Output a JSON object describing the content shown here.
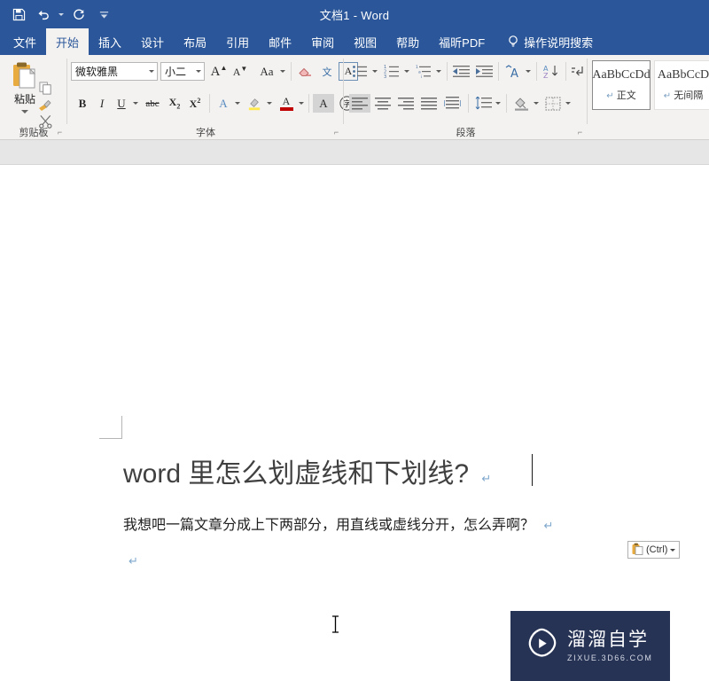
{
  "titlebar": {
    "document_title": "文档1  -  Word",
    "quick_access": [
      {
        "name": "save",
        "icon": "save-icon"
      },
      {
        "name": "undo",
        "icon": "undo-icon"
      },
      {
        "name": "redo",
        "icon": "redo-icon"
      },
      {
        "name": "customize",
        "icon": "customize-quick-access-icon"
      }
    ]
  },
  "tabs": [
    {
      "label": "文件",
      "active": false
    },
    {
      "label": "开始",
      "active": true
    },
    {
      "label": "插入",
      "active": false
    },
    {
      "label": "设计",
      "active": false
    },
    {
      "label": "布局",
      "active": false
    },
    {
      "label": "引用",
      "active": false
    },
    {
      "label": "邮件",
      "active": false
    },
    {
      "label": "审阅",
      "active": false
    },
    {
      "label": "视图",
      "active": false
    },
    {
      "label": "帮助",
      "active": false
    },
    {
      "label": "福昕PDF",
      "active": false
    }
  ],
  "tell_me": {
    "label": "操作说明搜索",
    "icon": "lightbulb-icon"
  },
  "ribbon": {
    "groups": [
      {
        "name": "clipboard",
        "label": "剪贴板",
        "paste_label": "粘贴",
        "buttons": [
          {
            "name": "cut",
            "icon": "scissors-icon"
          },
          {
            "name": "copy",
            "icon": "copy-icon"
          },
          {
            "name": "format-painter",
            "icon": "paintbrush-icon"
          }
        ]
      },
      {
        "name": "font",
        "label": "字体",
        "font_name": "微软雅黑",
        "font_size": "小二",
        "buttons": [
          {
            "name": "grow-font",
            "glyph": "A"
          },
          {
            "name": "shrink-font",
            "glyph": "A"
          },
          {
            "name": "change-case",
            "glyph": "Aa"
          },
          {
            "name": "clear-formatting",
            "icon": "eraser-icon"
          },
          {
            "name": "phonetic-guide",
            "glyph": "文"
          },
          {
            "name": "character-border",
            "glyph": "A"
          },
          {
            "name": "bold",
            "glyph": "B"
          },
          {
            "name": "italic",
            "glyph": "I"
          },
          {
            "name": "underline",
            "glyph": "U"
          },
          {
            "name": "strikethrough",
            "glyph": "abc"
          },
          {
            "name": "subscript",
            "glyph": "X₂"
          },
          {
            "name": "superscript",
            "glyph": "X²"
          },
          {
            "name": "text-effects",
            "glyph": "A"
          },
          {
            "name": "text-highlight-color",
            "glyph": "ab"
          },
          {
            "name": "font-color",
            "glyph": "A"
          },
          {
            "name": "character-shading",
            "glyph": "A"
          },
          {
            "name": "enclose-characters",
            "glyph": "字"
          }
        ]
      },
      {
        "name": "paragraph",
        "label": "段落",
        "buttons": [
          {
            "name": "bullets",
            "icon": "bullet-list-icon"
          },
          {
            "name": "numbering",
            "icon": "numbered-list-icon"
          },
          {
            "name": "multilevel-list",
            "icon": "multilevel-list-icon"
          },
          {
            "name": "decrease-indent",
            "icon": "decrease-indent-icon"
          },
          {
            "name": "increase-indent",
            "icon": "increase-indent-icon"
          },
          {
            "name": "asian-layout",
            "glyph": "A"
          },
          {
            "name": "sort",
            "glyph": "AZ"
          },
          {
            "name": "show-hide-marks",
            "glyph": "¶"
          },
          {
            "name": "align-left",
            "icon": "align-left-icon"
          },
          {
            "name": "align-center",
            "icon": "align-center-icon"
          },
          {
            "name": "align-right",
            "icon": "align-right-icon"
          },
          {
            "name": "justify",
            "icon": "justify-icon"
          },
          {
            "name": "distribute",
            "icon": "distribute-icon"
          },
          {
            "name": "line-spacing",
            "icon": "line-spacing-icon"
          },
          {
            "name": "shading",
            "icon": "shading-icon"
          },
          {
            "name": "borders",
            "icon": "borders-icon"
          }
        ]
      },
      {
        "name": "styles",
        "label": "",
        "items": [
          {
            "sample": "AaBbCcDd",
            "pilcrow": "↵",
            "name": "正文",
            "selected": true
          },
          {
            "sample": "AaBbCcD",
            "pilcrow": "↵",
            "name": "无间隔",
            "selected": false
          }
        ]
      }
    ]
  },
  "document": {
    "title_line": "word 里怎么划虚线和下划线?",
    "title_pilcrow": "↵",
    "body_line": "我想吧一篇文章分成上下两部分，用直线或虚线分开，怎么弄啊？",
    "body_pilcrow": "↵",
    "empty_pilcrow": "↵"
  },
  "paste_options": {
    "label": "(Ctrl)",
    "icon": "clipboard-icon"
  },
  "watermark": {
    "brand": "溜溜自学",
    "url": "ZIXUE.3D66.COM",
    "icon": "play-button-icon",
    "bg_color": "#263355"
  },
  "cursor": {
    "icon": "i-beam-cursor"
  },
  "colors": {
    "titlebar": "#2b579a",
    "ribbon_bg": "#f3f2f1",
    "page_bg": "#ffffff",
    "doc_surround": "#e6e6e6",
    "pilcrow": "#7fa8cd"
  }
}
